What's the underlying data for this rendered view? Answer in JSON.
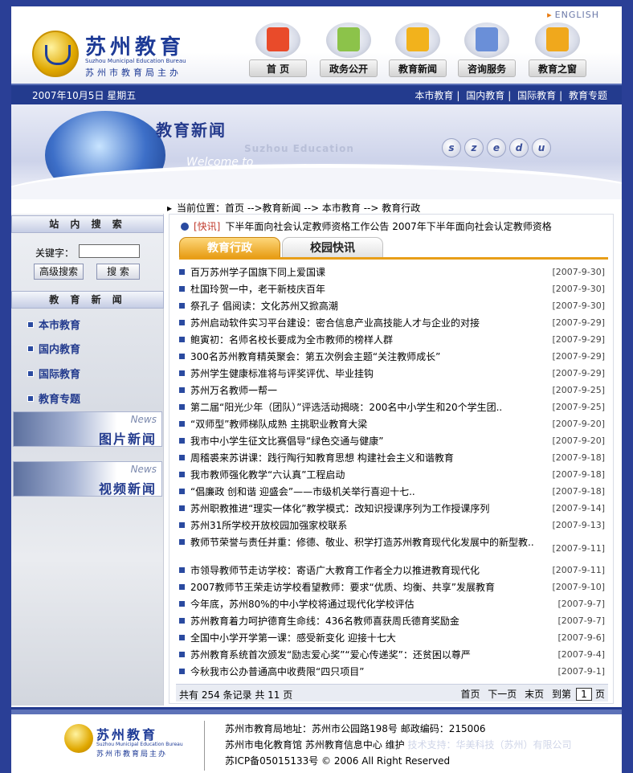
{
  "header": {
    "english_link": "ENGLISH",
    "logo_cn": "苏州教育",
    "logo_en": "Suzhou Municipal Education Bureau",
    "logo_sub": "苏州市教育局主办",
    "nav": [
      {
        "label": "首 页",
        "icon": "home-icon",
        "color": "#e94b2a"
      },
      {
        "label": "政务公开",
        "icon": "document-icon",
        "color": "#8cc34a"
      },
      {
        "label": "教育新闻",
        "icon": "news-icon",
        "color": "#f2b21c"
      },
      {
        "label": "咨询服务",
        "icon": "consult-icon",
        "color": "#6a8fd8"
      },
      {
        "label": "教育之窗",
        "icon": "folder-icon",
        "color": "#f0a81c"
      }
    ]
  },
  "datebar": {
    "date": "2007年10月5日  星期五",
    "links": [
      "本市教育",
      "国内教育",
      "国际教育",
      "教育专题"
    ]
  },
  "banner": {
    "title": "教育新闻",
    "en": "Suzhou Education",
    "welcome": "Welcome to",
    "letters": [
      "s",
      "z",
      "e",
      "d",
      "u"
    ]
  },
  "breadcrumb": "当前位置：首页 -->教育新闻 --> 本市教育 --> 教育行政",
  "sidebar": {
    "search_title": "站 内 搜 索",
    "keyword_label": "关键字：",
    "advanced_button": "高级搜索",
    "search_button": "搜 索",
    "news_title": "教 育 新 闻",
    "categories": [
      "本市教育",
      "国内教育",
      "国际教育",
      "教育专题"
    ],
    "promo_photo": {
      "news": "News",
      "label": "图片新闻"
    },
    "promo_video": {
      "news": "News",
      "label": "视频新闻"
    }
  },
  "main": {
    "flash_tag": "[快讯]",
    "flash_text": "下半年面向社会认定教师资格工作公告      2007年下半年面向社会认定教师资格",
    "tabs": [
      "教育行政",
      "校园快讯"
    ],
    "items": [
      {
        "title": "百万苏州学子国旗下同上爱国课",
        "date": "[2007-9-30]"
      },
      {
        "title": "杜国玲贺一中，老干新枝庆百年",
        "date": "[2007-9-30]"
      },
      {
        "title": "祭孔子  倡阅读：文化苏州又掀高潮",
        "date": "[2007-9-30]"
      },
      {
        "title": "苏州启动软件实习平台建设：密合信息产业高技能人才与企业的对接",
        "date": "[2007-9-29]"
      },
      {
        "title": "鲍寅初：名师名校长要成为全市教师的榜样人群",
        "date": "[2007-9-29]"
      },
      {
        "title": "300名苏州教育精英聚会：第五次例会主题“关注教师成长”",
        "date": "[2007-9-29]"
      },
      {
        "title": "苏州学生健康标准将与评奖评优、毕业挂钩",
        "date": "[2007-9-29]"
      },
      {
        "title": "苏州万名教师一帮一",
        "date": "[2007-9-25]"
      },
      {
        "title": "第二届“阳光少年（团队）”评选活动揭晓：200名中小学生和20个学生团..",
        "date": "[2007-9-25]"
      },
      {
        "title": "“双师型”教师梯队成熟 主挑职业教育大梁",
        "date": "[2007-9-20]"
      },
      {
        "title": "我市中小学生征文比赛倡导“绿色交通与健康”",
        "date": "[2007-9-20]"
      },
      {
        "title": "周稽裘来苏讲课：践行陶行知教育思想 构建社会主义和谐教育",
        "date": "[2007-9-18]"
      },
      {
        "title": "我市教师强化教学“六认真”工程启动",
        "date": "[2007-9-18]"
      },
      {
        "title": "“倡廉政 创和谐 迎盛会”——市级机关举行喜迎十七..",
        "date": "[2007-9-18]"
      },
      {
        "title": "苏州职教推进“理实一体化”教学模式：改知识授课序列为工作授课序列",
        "date": "[2007-9-14]"
      },
      {
        "title": "苏州31所学校开放校园加强家校联系",
        "date": "[2007-9-13]"
      },
      {
        "title": "教师节荣誉与责任并重：修德、敬业、积学打造苏州教育现代化发展中的新型教..",
        "date": "[2007-9-11]",
        "tall": true
      },
      {
        "title": "市领导教师节走访学校：寄语广大教育工作者全力以推进教育现代化",
        "date": "[2007-9-11]"
      },
      {
        "title": "2007教师节王荣走访学校看望教师：要求“优质、均衡、共享”发展教育",
        "date": "[2007-9-10]"
      },
      {
        "title": "今年底，苏州80%的中小学校将通过现代化学校评估",
        "date": "[2007-9-7]"
      },
      {
        "title": "苏州教育着力呵护德育生命线：436名教师喜获周氏德育奖励金",
        "date": "[2007-9-7]"
      },
      {
        "title": "全国中小学开学第一课：感受新变化 迎接十七大",
        "date": "[2007-9-6]"
      },
      {
        "title": "苏州教育系统首次颁发“励志爱心奖”“爱心传递奖”：还贫困以尊严",
        "date": "[2007-9-4]"
      },
      {
        "title": "今秋我市公办普通高中收费限“四只项目”",
        "date": "[2007-9-1]"
      }
    ],
    "pager": {
      "count": "共有 254 条记录  共 11 页",
      "first": "首页",
      "next": "下一页",
      "last": "末页",
      "goto": "到第",
      "page": "1",
      "page_suffix": "页"
    }
  },
  "footer": {
    "logo_cn": "苏州教育",
    "logo_en": "Suzhou Municipal Education Bureau",
    "logo_sub": "苏州市教育局主办",
    "line1": "苏州市教育局地址：苏州市公园路198号  邮政编码：215006",
    "line2": "苏州市电化教育馆  苏州教育信息中心  维护",
    "line2_faint": "技术支持：华美科技（苏州）有限公司",
    "line3": "苏ICP备05015133号  © 2006 All Right Reserved"
  },
  "colors": {
    "navy": "#233b8e",
    "orange": "#e89e18",
    "bullet": "#2a4aa0"
  }
}
